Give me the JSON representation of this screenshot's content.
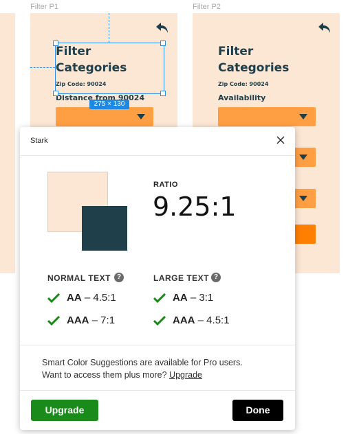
{
  "canvas": {
    "frames": [
      {
        "label": "Filter P1",
        "title_line1": "Filter",
        "title_line2": "Categories",
        "zip": "Zip Code: 90024",
        "field_label": "Distance from 90024",
        "selection_size": "275 × 130"
      },
      {
        "label": "Filter P2",
        "title_line1": "Filter",
        "title_line2": "Categories",
        "zip": "Zip Code: 90024",
        "field_label": "Availability"
      }
    ],
    "colors": {
      "frame_bg": "#fce6d4",
      "select_orange": "#ff9f43",
      "button_orange": "#ff7f00",
      "text_dark": "#1f3f4a",
      "selection_blue": "#2f8ce8"
    }
  },
  "dialog": {
    "title": "Stark",
    "ratio_label": "RATIO",
    "ratio_value": "9.25:1",
    "swatches": {
      "background": "#fce6d4",
      "foreground": "#1f3f4a"
    },
    "normal_text": {
      "label": "NORMAL TEXT",
      "aa_level": "AA",
      "aa_ratio": "– 4.5:1",
      "aaa_level": "AAA",
      "aaa_ratio": "– 7:1"
    },
    "large_text": {
      "label": "LARGE TEXT",
      "aa_level": "AA",
      "aa_ratio": "– 3:1",
      "aaa_level": "AAA",
      "aaa_ratio": "– 4.5:1"
    },
    "help_glyph": "?",
    "pro_line1": "Smart Color Suggestions are available for Pro users.",
    "pro_line2": "Want to access them plus more?",
    "pro_link": "Upgrade",
    "upgrade_button": "Upgrade",
    "done_button": "Done",
    "colors": {
      "pass_check": "#1a8a1a",
      "upgrade_bg": "#1a8a1a",
      "done_bg": "#000000"
    }
  }
}
